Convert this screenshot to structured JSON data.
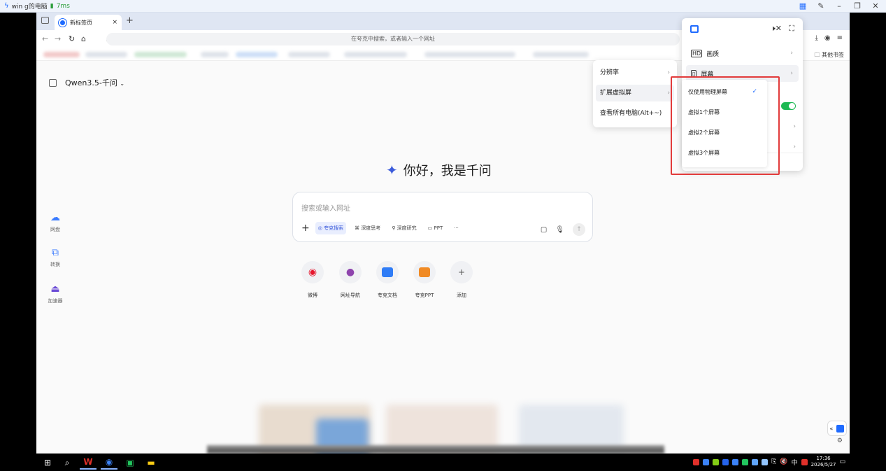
{
  "remote_session": {
    "title": "win g的电脑",
    "latency": "7ms",
    "controls": [
      "grid-icon",
      "edit-icon",
      "minimize-icon",
      "restore-icon",
      "close-icon"
    ]
  },
  "browser": {
    "tab_label": "新标签页",
    "tab_close": "×",
    "new_tab": "+",
    "address_placeholder": "在夸克中搜索，或者输入一个网址",
    "bookmarks_other": "其他书签"
  },
  "page": {
    "model_selector": "Qwen3.5-千问",
    "greeting": "你好，我是千问",
    "search_placeholder": "搜索或输入网址",
    "tools": [
      "夸克搜索",
      "深度思考",
      "深度研究",
      "PPT",
      "···"
    ],
    "left_nav": [
      "网盘",
      "转换",
      "加速器"
    ],
    "shortcuts": [
      "微博",
      "网址导航",
      "夸克文档",
      "夸克PPT",
      "添加"
    ]
  },
  "panel": {
    "items": [
      "画质",
      "屏幕"
    ],
    "hover_item": "屏幕"
  },
  "resolution_menu": {
    "items": [
      "分辨率",
      "扩展虚拟屏",
      "查看所有电脑(Alt+~)"
    ],
    "hover_item": "扩展虚拟屏"
  },
  "screen_menu": {
    "items": [
      "仅使用物理屏幕",
      "虚拟1个屏幕",
      "虚拟2个屏幕",
      "虚拟3个屏幕"
    ],
    "selected": "仅使用物理屏幕"
  },
  "taskbar": {
    "tray_input": "中",
    "time": "17:36",
    "date": "2026/5/27"
  },
  "colors": {
    "accent": "#1f6bff",
    "highlight_box": "#e23b3b",
    "toggle_on": "#1db954"
  }
}
